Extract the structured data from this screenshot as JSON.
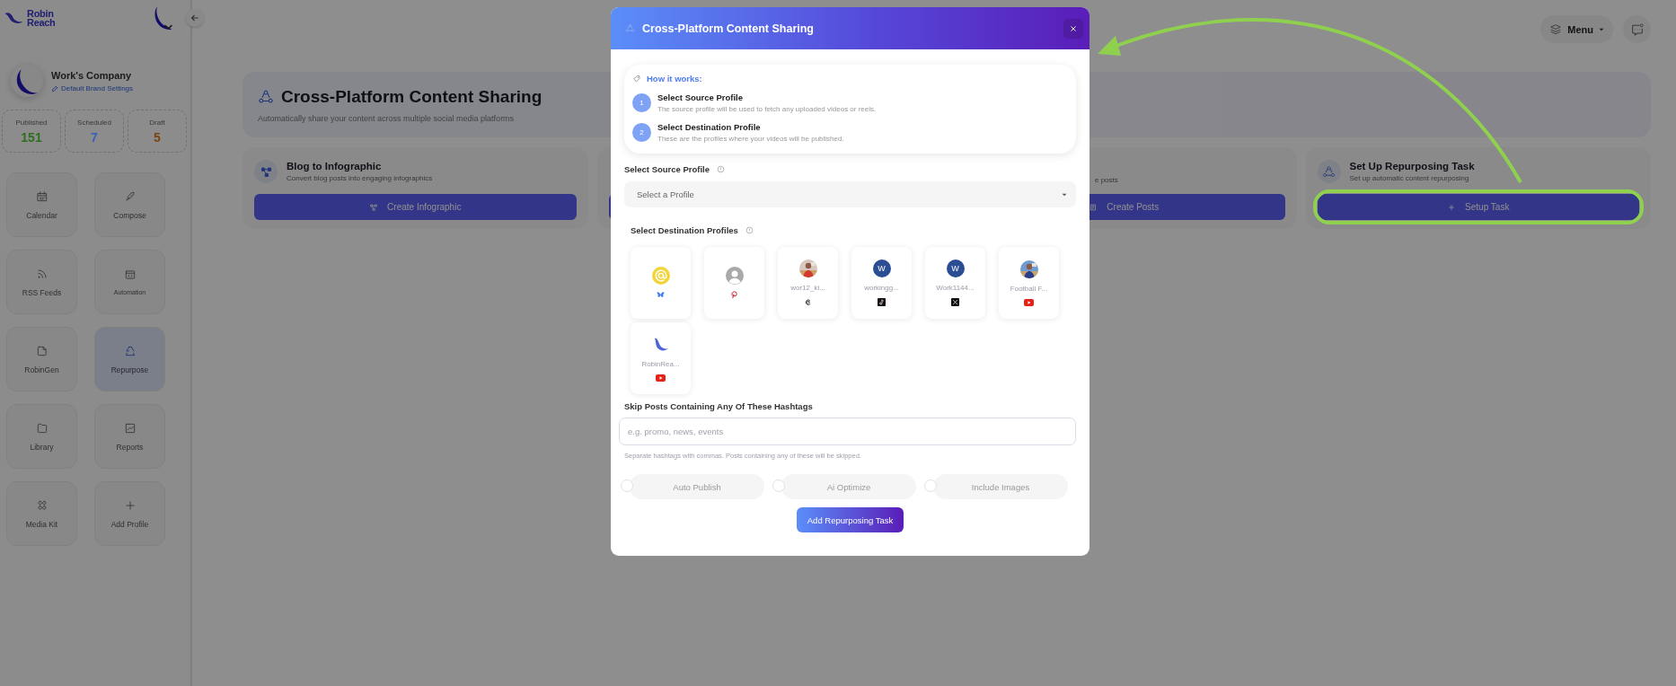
{
  "sidebar": {
    "brand": [
      "Robin",
      "Reach"
    ],
    "company": {
      "name": "Work's Company",
      "link": "Default Brand Settings"
    },
    "stats": [
      {
        "label": "Published",
        "value": "151",
        "color": "#2f6e1e"
      },
      {
        "label": "Scheduled",
        "value": "7",
        "color": "#3a60b8"
      },
      {
        "label": "Draft",
        "value": "5",
        "color": "#7a4510"
      }
    ],
    "nav": [
      {
        "label": "Calendar",
        "selected": false
      },
      {
        "label": "Compose",
        "selected": false
      },
      {
        "label": "RSS Feeds",
        "selected": false
      },
      {
        "label": "Automation",
        "selected": false
      },
      {
        "label": "RobinGen",
        "selected": false
      },
      {
        "label": "Repurpose",
        "selected": true
      },
      {
        "label": "Library",
        "selected": false
      },
      {
        "label": "Reports",
        "selected": false
      },
      {
        "label": "Media Kit",
        "selected": false
      },
      {
        "label": "Add Profile",
        "selected": false
      }
    ]
  },
  "header": {
    "menu": "Menu"
  },
  "hero": {
    "title": "Cross-Platform Content Sharing",
    "subtitle": "Automatically share your content across multiple social media platforms"
  },
  "cards": [
    {
      "kind": "full",
      "title": "Blog to Infographic",
      "description": "Convert blog posts into engaging infographics",
      "button": "Create Infographic",
      "highlighted": false
    },
    {
      "kind": "hidden"
    },
    {
      "kind": "partial",
      "description": "e posts",
      "button": "Create Posts"
    },
    {
      "kind": "full",
      "title": "Set Up Repurposing Task",
      "description": "Set up automatic content repurposing",
      "button": "Setup Task",
      "highlighted": true
    }
  ],
  "modal": {
    "title": "Cross-Platform Content Sharing",
    "how_it_works": {
      "heading": "How it works:",
      "steps": [
        {
          "number": "1",
          "title": "Select Source Profile",
          "description": "The source profile will be used to fetch any uploaded videos or reels."
        },
        {
          "number": "2",
          "title": "Select Destination Profile",
          "description": "These are the profiles where your videos will be published."
        }
      ]
    },
    "source_label": "Select Source Profile",
    "source_select": {
      "placeholder": "Select a Profile"
    },
    "destination_label": "Select Destination Profiles",
    "profiles": [
      {
        "kind": "icon"
      },
      {
        "kind": "placeholder"
      },
      {
        "name": "wor12_ki..."
      },
      {
        "kind": "letter",
        "letter": "W",
        "name": "workingg..."
      },
      {
        "kind": "letter",
        "letter": "W",
        "name": "Work1144..."
      },
      {
        "name": "Football F..."
      },
      {
        "kind": "logo",
        "name": "RobinRea..."
      }
    ],
    "hashtags": {
      "label": "Skip Posts Containing Any Of These Hashtags",
      "placeholder": "e.g. promo, news, events",
      "hint": "Separate hashtags with commas. Posts containing any of these will be skipped."
    },
    "options": [
      {
        "label": "Auto Publish",
        "checked": false
      },
      {
        "label": "Ai Optimize",
        "checked": false
      },
      {
        "label": "Include Images",
        "checked": false
      }
    ],
    "submit": "Add Repurposing Task"
  }
}
